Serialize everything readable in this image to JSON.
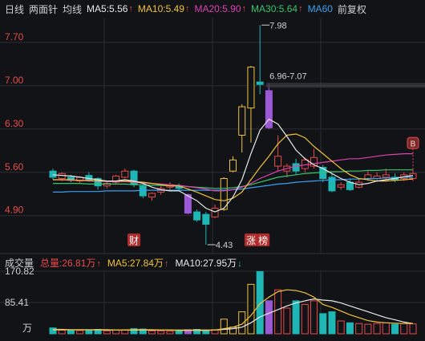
{
  "header": {
    "period": "日线",
    "adjust_mode": "两面针",
    "ma_label": "均线",
    "ma5": "MA5:5.56",
    "ma10": "MA10:5.49",
    "ma20": "MA20:5.90",
    "ma30": "MA30:5.64",
    "ma60": "MA60",
    "fq_button": "前复权",
    "ma5_dir": "up",
    "ma10_dir": "up",
    "ma20_dir": "up",
    "ma30_dir": "up"
  },
  "volume_header": {
    "title": "成交量",
    "total": "总量:26.81万",
    "ma5": "MA5:27.84万",
    "ma10": "MA10:27.95万",
    "total_dir": "up",
    "ma5_dir": "up",
    "ma10_dir": "down"
  },
  "colors": {
    "up": "#e84a4a",
    "down": "#1fb7b5",
    "special": "#9b59d6",
    "limit_up": "#f0c23a",
    "ma5": "#e8e8e8",
    "ma10": "#f0c23a",
    "ma20": "#e040b0",
    "ma30": "#39c56b",
    "ma60": "#3aa0f0",
    "grid": "#2a2d33",
    "axis_text_up": "#e84a4a",
    "axis_text": "#d0d0d0"
  },
  "chart_data": {
    "type": "candlestick",
    "yticks": [
      "7.70",
      "7.00",
      "6.30",
      "5.60",
      "4.90"
    ],
    "ylim": [
      4.3,
      8.1
    ],
    "vol_yticks": [
      "170.82",
      "85.41"
    ],
    "vol_unit": "万",
    "vol_ylim": [
      0,
      170.82
    ],
    "annotations": {
      "high": "7.98",
      "low": "4.43",
      "range": "6.96-7.07",
      "marker_b": "B",
      "tag_cai": "财",
      "tag_zhang": "涨",
      "tag_bang": "榜"
    },
    "candles": [
      {
        "o": 5.62,
        "c": 5.52,
        "h": 5.66,
        "l": 5.48,
        "v": 16,
        "s": "d"
      },
      {
        "o": 5.5,
        "c": 5.58,
        "h": 5.6,
        "l": 5.46,
        "v": 10,
        "s": "u"
      },
      {
        "o": 5.52,
        "c": 5.47,
        "h": 5.56,
        "l": 5.44,
        "v": 9,
        "s": "d"
      },
      {
        "o": 5.46,
        "c": 5.52,
        "h": 5.54,
        "l": 5.43,
        "v": 9,
        "s": "u"
      },
      {
        "o": 5.55,
        "c": 5.48,
        "h": 5.6,
        "l": 5.45,
        "v": 10,
        "s": "d"
      },
      {
        "o": 5.5,
        "c": 5.38,
        "h": 5.52,
        "l": 5.32,
        "v": 12,
        "s": "d"
      },
      {
        "o": 5.38,
        "c": 5.42,
        "h": 5.45,
        "l": 5.34,
        "v": 8,
        "s": "u"
      },
      {
        "o": 5.44,
        "c": 5.54,
        "h": 5.56,
        "l": 5.4,
        "v": 10,
        "s": "u"
      },
      {
        "o": 5.52,
        "c": 5.62,
        "h": 5.66,
        "l": 5.5,
        "v": 11,
        "s": "u"
      },
      {
        "o": 5.62,
        "c": 5.4,
        "h": 5.64,
        "l": 5.36,
        "v": 14,
        "s": "d"
      },
      {
        "o": 5.38,
        "c": 5.22,
        "h": 5.4,
        "l": 5.18,
        "v": 13,
        "s": "d"
      },
      {
        "o": 5.2,
        "c": 5.26,
        "h": 5.28,
        "l": 5.14,
        "v": 8,
        "s": "u"
      },
      {
        "o": 5.28,
        "c": 5.34,
        "h": 5.38,
        "l": 5.24,
        "v": 8,
        "s": "u"
      },
      {
        "o": 5.36,
        "c": 5.4,
        "h": 5.44,
        "l": 5.32,
        "v": 7,
        "s": "u"
      },
      {
        "o": 5.38,
        "c": 5.34,
        "h": 5.42,
        "l": 5.3,
        "v": 7,
        "s": "d"
      },
      {
        "o": 5.24,
        "c": 4.94,
        "h": 5.26,
        "l": 4.92,
        "v": 11,
        "s": "p"
      },
      {
        "o": 4.96,
        "c": 4.83,
        "h": 5.0,
        "l": 4.8,
        "v": 12,
        "s": "d"
      },
      {
        "o": 4.92,
        "c": 4.76,
        "h": 4.96,
        "l": 4.43,
        "v": 10,
        "s": "d"
      },
      {
        "o": 4.88,
        "c": 5.02,
        "h": 5.08,
        "l": 4.86,
        "v": 11,
        "s": "u"
      },
      {
        "o": 5.0,
        "c": 5.5,
        "h": 5.52,
        "l": 4.98,
        "v": 40,
        "s": "l"
      },
      {
        "o": 5.8,
        "c": 5.62,
        "h": 5.86,
        "l": 5.6,
        "v": 18,
        "s": "l"
      },
      {
        "o": 6.2,
        "c": 6.66,
        "h": 6.7,
        "l": 5.92,
        "v": 60,
        "s": "l"
      },
      {
        "o": 6.64,
        "c": 7.3,
        "h": 7.32,
        "l": 6.08,
        "v": 135,
        "s": "l"
      },
      {
        "o": 7.02,
        "c": 7.06,
        "h": 7.98,
        "l": 6.86,
        "v": 170,
        "s": "d"
      },
      {
        "o": 6.92,
        "c": 6.32,
        "h": 7.04,
        "l": 6.3,
        "v": 90,
        "s": "p"
      },
      {
        "o": 5.86,
        "c": 5.7,
        "h": 6.2,
        "l": 5.62,
        "v": 120,
        "s": "u"
      },
      {
        "o": 5.62,
        "c": 5.7,
        "h": 5.74,
        "l": 5.52,
        "v": 70,
        "s": "u"
      },
      {
        "o": 5.74,
        "c": 5.62,
        "h": 5.82,
        "l": 5.56,
        "v": 90,
        "s": "d"
      },
      {
        "o": 5.66,
        "c": 5.8,
        "h": 5.84,
        "l": 5.6,
        "v": 80,
        "s": "u"
      },
      {
        "o": 5.84,
        "c": 5.7,
        "h": 5.98,
        "l": 5.66,
        "v": 90,
        "s": "u"
      },
      {
        "o": 5.68,
        "c": 5.5,
        "h": 5.72,
        "l": 5.44,
        "v": 55,
        "s": "d"
      },
      {
        "o": 5.52,
        "c": 5.3,
        "h": 5.58,
        "l": 5.28,
        "v": 60,
        "s": "d"
      },
      {
        "o": 5.36,
        "c": 5.4,
        "h": 5.44,
        "l": 5.32,
        "v": 35,
        "s": "u"
      },
      {
        "o": 5.44,
        "c": 5.32,
        "h": 5.5,
        "l": 5.3,
        "v": 30,
        "s": "d"
      },
      {
        "o": 5.36,
        "c": 5.44,
        "h": 5.5,
        "l": 5.34,
        "v": 28,
        "s": "u"
      },
      {
        "o": 5.5,
        "c": 5.56,
        "h": 5.62,
        "l": 5.46,
        "v": 26,
        "s": "u"
      },
      {
        "o": 5.54,
        "c": 5.5,
        "h": 5.6,
        "l": 5.46,
        "v": 28,
        "s": "u"
      },
      {
        "o": 5.56,
        "c": 5.52,
        "h": 5.66,
        "l": 5.48,
        "v": 30,
        "s": "u"
      },
      {
        "o": 5.52,
        "c": 5.48,
        "h": 5.58,
        "l": 5.44,
        "v": 26,
        "s": "d"
      },
      {
        "o": 5.5,
        "c": 5.56,
        "h": 5.6,
        "l": 5.46,
        "v": 28,
        "s": "u"
      },
      {
        "o": 5.5,
        "c": 5.58,
        "h": 5.64,
        "l": 5.46,
        "v": 27,
        "s": "u"
      }
    ],
    "ma5_line": [
      5.56,
      5.55,
      5.54,
      5.52,
      5.5,
      5.48,
      5.46,
      5.46,
      5.48,
      5.46,
      5.42,
      5.36,
      5.32,
      5.3,
      5.3,
      5.22,
      5.14,
      5.02,
      4.96,
      5.02,
      5.2,
      5.48,
      5.9,
      6.28,
      6.46,
      6.38,
      6.18,
      5.96,
      5.82,
      5.72,
      5.66,
      5.58,
      5.5,
      5.44,
      5.4,
      5.42,
      5.46,
      5.48,
      5.5,
      5.53,
      5.55
    ],
    "ma10_line": [
      5.48,
      5.48,
      5.48,
      5.47,
      5.47,
      5.46,
      5.46,
      5.46,
      5.46,
      5.45,
      5.44,
      5.42,
      5.4,
      5.38,
      5.38,
      5.33,
      5.28,
      5.22,
      5.16,
      5.14,
      5.18,
      5.28,
      5.48,
      5.68,
      5.86,
      6.06,
      6.2,
      6.22,
      6.16,
      6.02,
      5.9,
      5.78,
      5.66,
      5.56,
      5.5,
      5.48,
      5.46,
      5.46,
      5.47,
      5.48,
      5.49
    ],
    "ma20_line": [
      5.48,
      5.48,
      5.47,
      5.47,
      5.46,
      5.46,
      5.45,
      5.45,
      5.45,
      5.44,
      5.43,
      5.42,
      5.41,
      5.4,
      5.39,
      5.37,
      5.35,
      5.33,
      5.3,
      5.3,
      5.32,
      5.36,
      5.42,
      5.5,
      5.56,
      5.62,
      5.66,
      5.7,
      5.72,
      5.74,
      5.76,
      5.78,
      5.8,
      5.82,
      5.82,
      5.84,
      5.86,
      5.88,
      5.89,
      5.9,
      5.9
    ],
    "ma30_line": [
      5.42,
      5.42,
      5.42,
      5.42,
      5.41,
      5.41,
      5.41,
      5.41,
      5.41,
      5.4,
      5.4,
      5.39,
      5.39,
      5.38,
      5.38,
      5.37,
      5.36,
      5.35,
      5.34,
      5.34,
      5.35,
      5.37,
      5.4,
      5.44,
      5.48,
      5.52,
      5.54,
      5.56,
      5.58,
      5.59,
      5.6,
      5.61,
      5.61,
      5.62,
      5.62,
      5.63,
      5.63,
      5.64,
      5.64,
      5.64,
      5.64
    ],
    "ma60_line": [
      5.28,
      5.28,
      5.29,
      5.29,
      5.29,
      5.29,
      5.3,
      5.3,
      5.3,
      5.3,
      5.31,
      5.31,
      5.31,
      5.31,
      5.31,
      5.31,
      5.31,
      5.31,
      5.31,
      5.31,
      5.32,
      5.33,
      5.35,
      5.37,
      5.39,
      5.41,
      5.42,
      5.44,
      5.45,
      5.46,
      5.47,
      5.48,
      5.48,
      5.49,
      5.49,
      5.5,
      5.5,
      5.51,
      5.51,
      5.52,
      5.52
    ],
    "vol_ma5_line": [
      12,
      12,
      11,
      11,
      11,
      10,
      10,
      10,
      10,
      11,
      11,
      11,
      10,
      10,
      9,
      9,
      9,
      9,
      10,
      14,
      18,
      26,
      50,
      82,
      100,
      115,
      120,
      118,
      112,
      100,
      80,
      72,
      62,
      52,
      44,
      36,
      32,
      30,
      29,
      28,
      28
    ],
    "vol_ma10_line": [
      11,
      11,
      11,
      11,
      11,
      11,
      11,
      10,
      10,
      10,
      10,
      10,
      10,
      10,
      10,
      10,
      10,
      10,
      10,
      12,
      14,
      18,
      30,
      46,
      56,
      66,
      76,
      84,
      90,
      95,
      92,
      90,
      84,
      76,
      68,
      60,
      52,
      44,
      38,
      32,
      28
    ]
  }
}
